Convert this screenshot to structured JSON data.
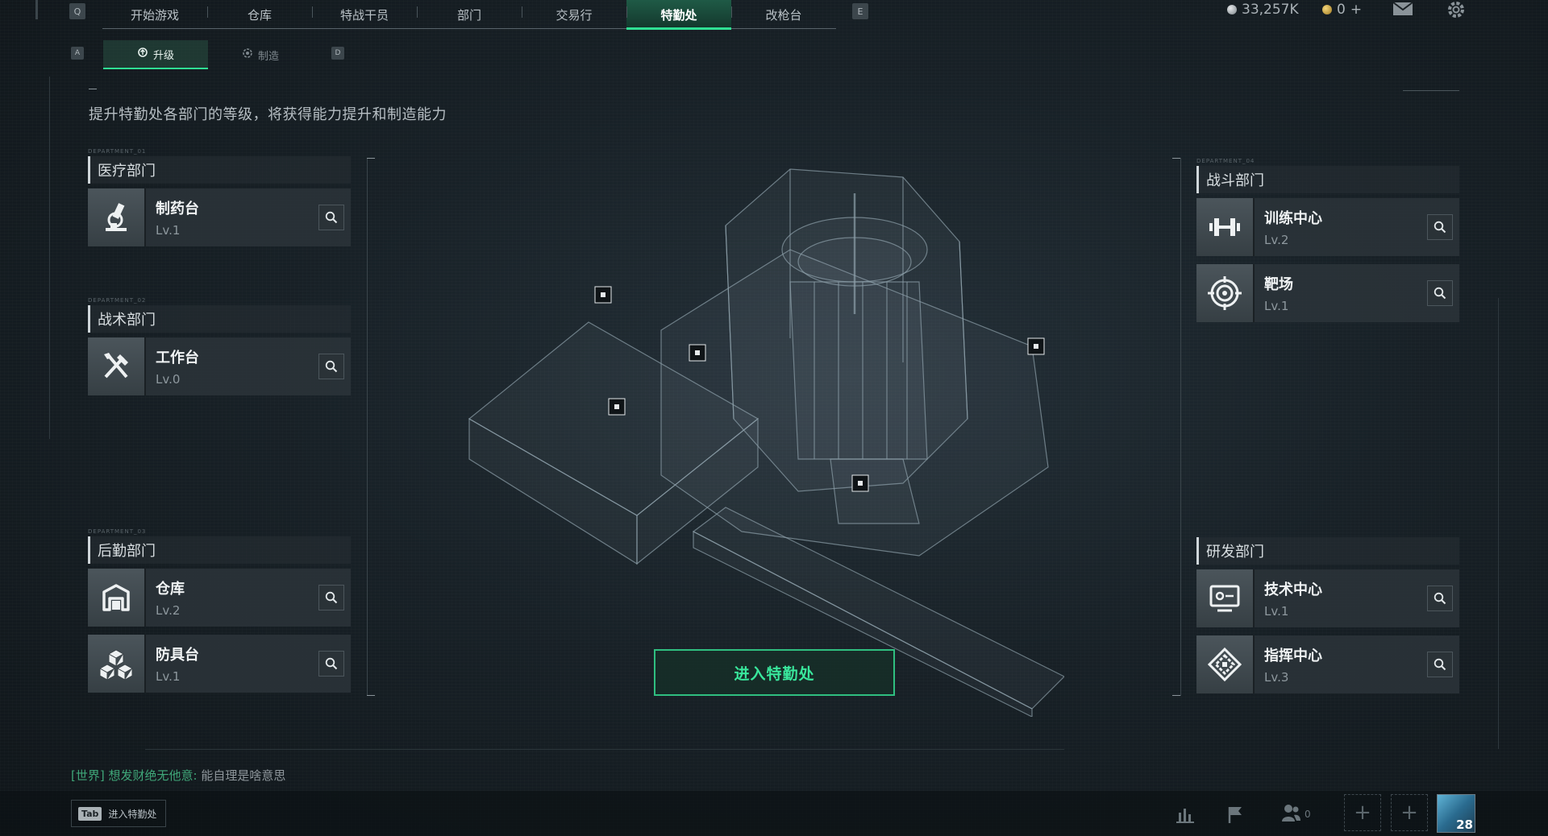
{
  "nav": {
    "left_key": "Q",
    "right_key": "E",
    "tabs": [
      "开始游戏",
      "仓库",
      "特战干员",
      "部门",
      "交易行",
      "特勤处",
      "改枪台"
    ],
    "active_tab": "特勤处"
  },
  "currency": {
    "silver": "33,257K",
    "gold": "0",
    "gold_add": "+"
  },
  "subtabs": {
    "left_key": "A",
    "right_key": "D",
    "upgrade": "升级",
    "craft": "制造"
  },
  "description": "提升特勤处各部门的等级，将获得能力提升和制造能力",
  "departments": {
    "medical": {
      "tag": "DEPARTMENT_01",
      "title": "医疗部门",
      "items": [
        {
          "name": "制药台",
          "level": "Lv.1",
          "icon": "microscope-icon"
        }
      ]
    },
    "tactical": {
      "tag": "DEPARTMENT_02",
      "title": "战术部门",
      "items": [
        {
          "name": "工作台",
          "level": "Lv.0",
          "icon": "tools-icon"
        }
      ]
    },
    "logistics": {
      "tag": "DEPARTMENT_03",
      "title": "后勤部门",
      "items": [
        {
          "name": "仓库",
          "level": "Lv.2",
          "icon": "warehouse-icon"
        },
        {
          "name": "防具台",
          "level": "Lv.1",
          "icon": "armor-cubes-icon"
        }
      ]
    },
    "combat": {
      "tag": "DEPARTMENT_04",
      "title": "战斗部门",
      "items": [
        {
          "name": "训练中心",
          "level": "Lv.2",
          "icon": "dumbbell-icon"
        },
        {
          "name": "靶场",
          "level": "Lv.1",
          "icon": "target-icon"
        }
      ]
    },
    "research": {
      "title": "研发部门",
      "items": [
        {
          "name": "技术中心",
          "level": "Lv.1",
          "icon": "computer-icon"
        },
        {
          "name": "指挥中心",
          "level": "Lv.3",
          "icon": "command-emblem-icon"
        }
      ]
    }
  },
  "center": {
    "enter_button": "进入特勤处"
  },
  "chat": {
    "channel": "[世界]",
    "sender": "想发财绝无他意:",
    "message": "能自理是啥意思"
  },
  "bottom": {
    "tab_key": "Tab",
    "tab_label": "进入特勤处",
    "friends_count": "0",
    "player_level": "28"
  },
  "colors": {
    "accent": "#2fe094",
    "panel": "#2c3439",
    "background": "#182127"
  }
}
